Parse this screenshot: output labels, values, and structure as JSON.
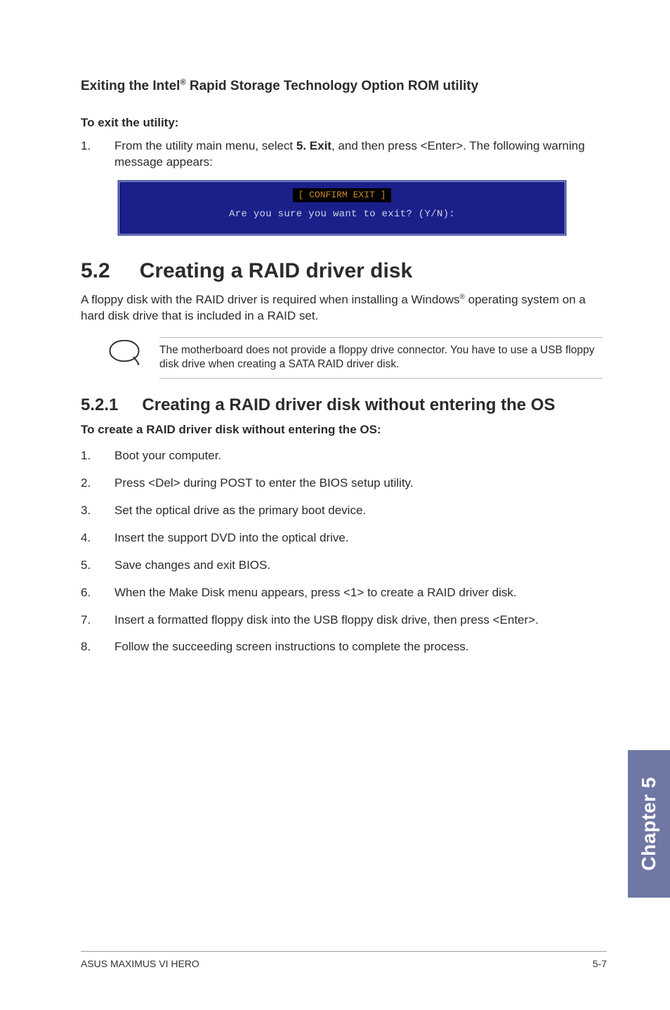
{
  "section_exit": {
    "heading_pre": "Exiting the Intel",
    "heading_sup": "®",
    "heading_post": " Rapid Storage Technology Option ROM utility",
    "sub": "To exit the utility:",
    "step1_num": "1.",
    "step1_pre": "From the utility main menu, select ",
    "step1_bold": "5. Exit",
    "step1_post": ", and then press <Enter>. The following warning message appears:",
    "bios_title": "[ CONFIRM EXIT ]",
    "bios_q": "Are you sure you want to exit? (Y/N):"
  },
  "section_52": {
    "num": "5.2",
    "title": "Creating a RAID driver disk",
    "body_pre": "A floppy disk with the RAID driver is required when installing a Windows",
    "body_sup": "®",
    "body_post": " operating system on a hard disk drive that is included in a RAID set.",
    "note": "The motherboard does not provide a floppy drive connector. You have to use a USB floppy disk drive when creating a SATA RAID driver disk."
  },
  "section_521": {
    "num": "5.2.1",
    "title": "Creating a RAID driver disk without entering the OS",
    "sub": "To create a RAID driver disk without entering the OS:",
    "steps": [
      {
        "n": "1.",
        "t": "Boot your computer."
      },
      {
        "n": "2.",
        "t": "Press <Del> during POST to enter the BIOS setup utility."
      },
      {
        "n": "3.",
        "t": "Set the optical drive as the primary boot device."
      },
      {
        "n": "4.",
        "t": "Insert the support DVD into the optical drive."
      },
      {
        "n": "5.",
        "t": "Save changes and exit BIOS."
      },
      {
        "n": "6.",
        "t": "When the Make Disk menu appears, press <1> to create a RAID driver disk."
      },
      {
        "n": "7.",
        "t": "Insert a formatted floppy disk into the USB floppy disk drive, then press <Enter>."
      },
      {
        "n": "8.",
        "t": "Follow the succeeding screen instructions to complete the process."
      }
    ]
  },
  "chapter_tab": "Chapter 5",
  "footer_left": "ASUS MAXIMUS VI HERO",
  "footer_right": "5-7"
}
